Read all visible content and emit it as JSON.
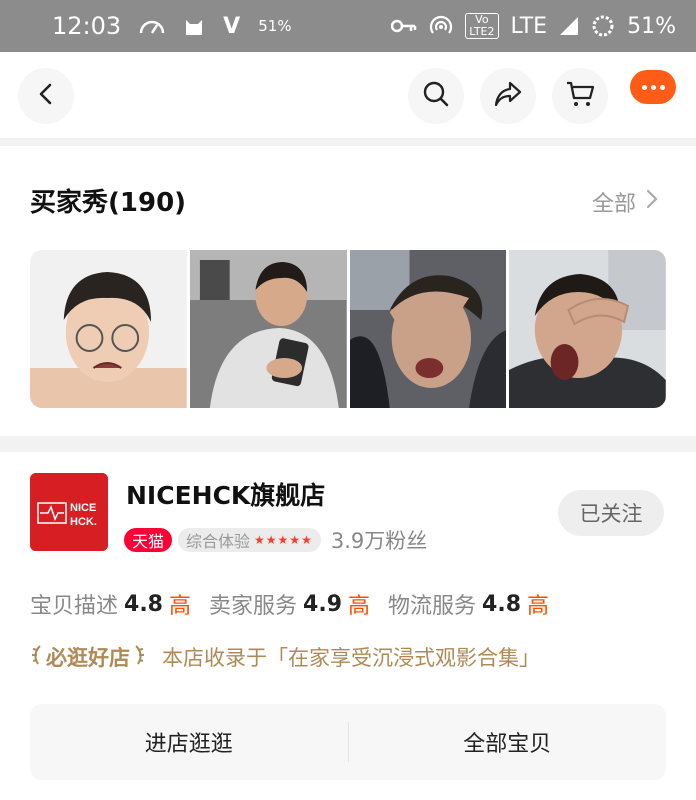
{
  "status_bar": {
    "time": "12:03",
    "vpn_letter": "V",
    "left_battery": "51%",
    "volte_top": "Vo",
    "volte_bottom": "LTE",
    "volte_num": "2",
    "network": "LTE",
    "battery": "51%"
  },
  "buyer_show": {
    "title": "买家秀(190)",
    "see_all": "全部"
  },
  "shop": {
    "logo_line1": "NICE",
    "logo_line2": "HCK.",
    "name": "NICEHCK旗舰店",
    "tmall_tag": "天猫",
    "experience_label": "综合体验",
    "experience_stars": "★★★★★",
    "fans": "3.9万粉丝",
    "follow_label": "已关注",
    "ratings": [
      {
        "label": "宝贝描述",
        "score": "4.8",
        "level": "高"
      },
      {
        "label": "卖家服务",
        "score": "4.9",
        "level": "高"
      },
      {
        "label": "物流服务",
        "score": "4.8",
        "level": "高"
      }
    ],
    "badge_label": "必逛好店",
    "recommend_text": "本店收录于「在家享受沉浸式观影合集」",
    "actions": {
      "enter_shop": "进店逛逛",
      "all_items": "全部宝贝"
    }
  },
  "colors": {
    "accent": "#ff5000",
    "tmall_red": "#ff0036",
    "logo_red": "#d61e23",
    "gold": "#b08a56"
  }
}
